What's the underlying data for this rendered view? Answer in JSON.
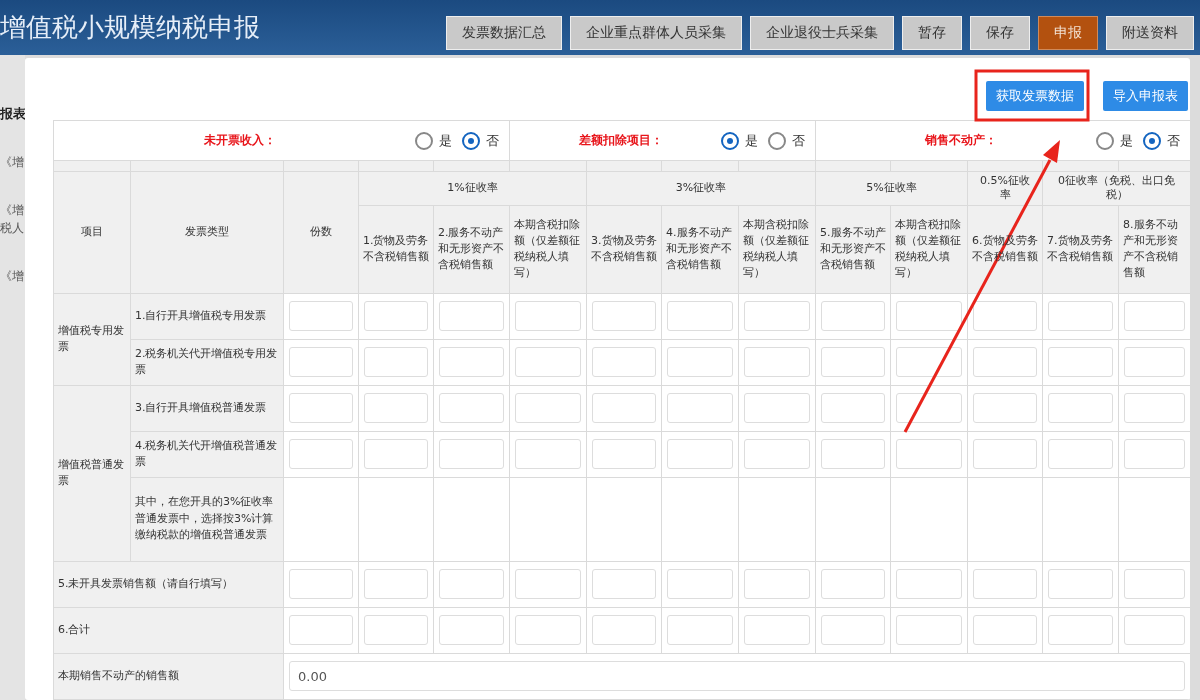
{
  "header": {
    "title": "增值税小规模纳税申报",
    "buttons": [
      {
        "label": "发票数据汇总",
        "selected": false
      },
      {
        "label": "企业重点群体人员采集",
        "selected": false
      },
      {
        "label": "企业退役士兵采集",
        "selected": false
      },
      {
        "label": "暂存",
        "selected": false
      },
      {
        "label": "保存",
        "selected": false
      },
      {
        "label": "申报",
        "selected": true
      },
      {
        "label": "附送资料",
        "selected": false
      }
    ]
  },
  "sidebar": {
    "title": "报表",
    "items": [
      "《增",
      "《增税人",
      "《增"
    ]
  },
  "modal": {
    "buttons": [
      {
        "label": "获取发票数据"
      },
      {
        "label": "导入申报表"
      }
    ],
    "options": [
      {
        "label": "未开票收入：",
        "choices": [
          {
            "label": "是",
            "selected": false
          },
          {
            "label": "否",
            "selected": true
          }
        ]
      },
      {
        "label": "差额扣除项目：",
        "choices": [
          {
            "label": "是",
            "selected": true
          },
          {
            "label": "否",
            "selected": false
          }
        ]
      },
      {
        "label": "销售不动产：",
        "choices": [
          {
            "label": "是",
            "selected": false
          },
          {
            "label": "否",
            "selected": true
          }
        ]
      }
    ],
    "table": {
      "fixed_headers": [
        "项目",
        "发票类型",
        "份数"
      ],
      "rate_groups": [
        {
          "label": "1%征收率",
          "columns": [
            "1.货物及劳务不含税销售额",
            "2.服务不动产和无形资产不含税销售额",
            "本期含税扣除额（仅差额征税纳税人填写）"
          ]
        },
        {
          "label": "3%征收率",
          "columns": [
            "3.货物及劳务不含税销售额",
            "4.服务不动产和无形资产不含税销售额",
            "本期含税扣除额（仅差额征税纳税人填写）"
          ]
        },
        {
          "label": "5%征收率",
          "columns": [
            "5.服务不动产和无形资产不含税销售额",
            "本期含税扣除额（仅差额征税纳税人填写）"
          ]
        },
        {
          "label": "0.5%征收率",
          "columns": [
            "6.货物及劳务不含税销售额"
          ]
        },
        {
          "label": "0征收率（免税、出口免税）",
          "columns": [
            "7.货物及劳务不含税销售额",
            "8.服务不动产和无形资产不含税销售额"
          ]
        }
      ],
      "body": [
        {
          "kind": "group",
          "label": "增值税专用发票",
          "rows": [
            {
              "kind": "input",
              "label": "1.自行开具增值税专用发票"
            },
            {
              "kind": "input",
              "label": "2.税务机关代开增值税专用发票"
            }
          ]
        },
        {
          "kind": "group",
          "label": "增值税普通发票",
          "rows": [
            {
              "kind": "input",
              "label": "3.自行开具增值税普通发票"
            },
            {
              "kind": "input",
              "label": "4.税务机关代开增值税普通发票"
            },
            {
              "kind": "note",
              "label": "其中，在您开具的3%征收率普通发票中，选择按3%计算缴纳税款的增值税普通发票"
            }
          ]
        },
        {
          "kind": "row",
          "label": "5.未开具发票销售额（请自行填写）"
        },
        {
          "kind": "row",
          "label": "6.合计"
        },
        {
          "kind": "value",
          "label": "本期销售不动产的销售额",
          "value": "0.00"
        }
      ]
    }
  }
}
